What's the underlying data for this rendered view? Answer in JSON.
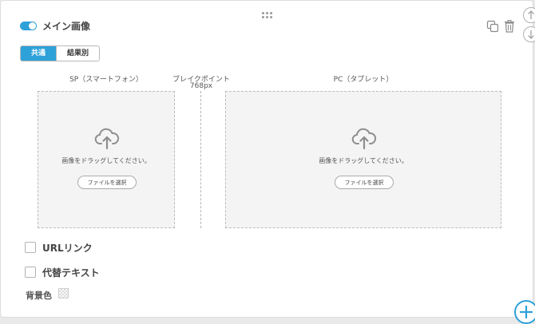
{
  "block": {
    "title": "メイン画像",
    "toggle_on": true,
    "accent_color": "#2ea1d8"
  },
  "tabs": [
    {
      "label": "共通",
      "active": true
    },
    {
      "label": "結果別",
      "active": false
    }
  ],
  "columns": {
    "sp_label": "SP（スマートフォン）",
    "pc_label": "PC（タブレット）",
    "breakpoint_label": "ブレイクポイント",
    "breakpoint_value": "768px"
  },
  "dropzones": {
    "sp": {
      "text": "画像をドラッグしてください。",
      "button": "ファイルを選択"
    },
    "pc": {
      "text": "画像をドラッグしてください。",
      "button": "ファイルを選択"
    }
  },
  "options": {
    "url_link": {
      "label": "URLリンク",
      "checked": false
    },
    "alt_text": {
      "label": "代替テキスト",
      "checked": false
    },
    "bg_color_label": "背景色"
  },
  "icons": {
    "drag": "drag-handle-icon",
    "copy": "copy-icon",
    "delete": "trash-icon",
    "move_up": "arrow-up-circle-icon",
    "move_down": "arrow-down-circle-icon",
    "add": "plus-circle-icon",
    "upload": "cloud-upload-icon"
  }
}
